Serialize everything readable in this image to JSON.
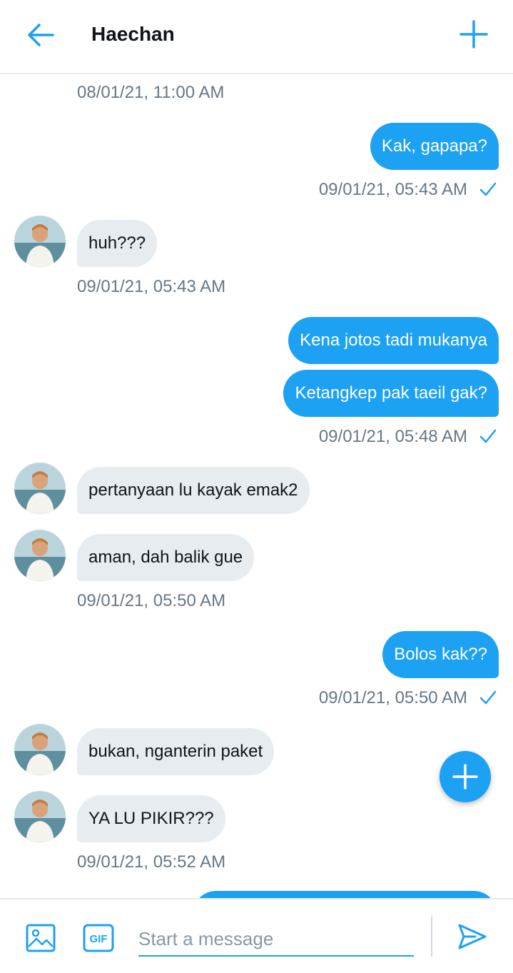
{
  "header": {
    "title": "Haechan",
    "back_icon": "arrow-left-icon",
    "add_icon": "plus-icon"
  },
  "colors": {
    "accent": "#1da1f2",
    "received_bubble": "#e6ecf0",
    "timestamp": "#657786"
  },
  "messages": [
    {
      "type": "timestamp",
      "side": "left",
      "text": "08/01/21, 11:00 AM"
    },
    {
      "type": "sent",
      "text": "Kak, gapapa?"
    },
    {
      "type": "timestamp",
      "side": "right",
      "text": "09/01/21, 05:43 AM",
      "read": true
    },
    {
      "type": "received",
      "text": "huh???"
    },
    {
      "type": "timestamp",
      "side": "left",
      "text": "09/01/21, 05:43 AM"
    },
    {
      "type": "sent",
      "text": "Kena jotos tadi mukanya"
    },
    {
      "type": "sent",
      "text": "Ketangkep pak taeil gak?"
    },
    {
      "type": "timestamp",
      "side": "right",
      "text": "09/01/21, 05:48 AM",
      "read": true
    },
    {
      "type": "received",
      "text": "pertanyaan lu kayak emak2"
    },
    {
      "type": "received",
      "text": "aman, dah balik gue"
    },
    {
      "type": "timestamp",
      "side": "left",
      "text": "09/01/21, 05:50 AM"
    },
    {
      "type": "sent",
      "text": "Bolos kak??"
    },
    {
      "type": "timestamp",
      "side": "right",
      "text": "09/01/21, 05:50 AM",
      "read": true
    },
    {
      "type": "received",
      "text": "bukan, nganterin paket"
    },
    {
      "type": "received",
      "text": "YA LU PIKIR???"
    },
    {
      "type": "timestamp",
      "side": "left",
      "text": "09/01/21, 05:52 AM"
    }
  ],
  "composer": {
    "placeholder": "Start a message",
    "media_icon": "image-icon",
    "gif_label": "GIF",
    "send_icon": "send-icon"
  },
  "fab_icon": "plus-icon"
}
